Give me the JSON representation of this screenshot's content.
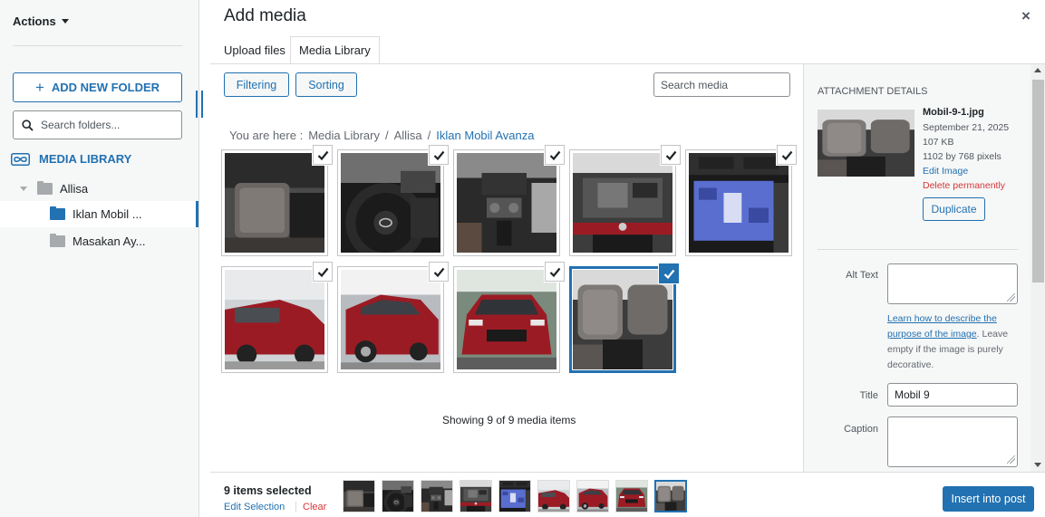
{
  "sidebar": {
    "actions_label": "Actions",
    "add_folder_label": "ADD NEW FOLDER",
    "search_placeholder": "Search folders...",
    "root_label": "MEDIA LIBRARY",
    "folders": [
      {
        "label": "Allisa",
        "level": 0,
        "expanded": true,
        "active": false
      },
      {
        "label": "Iklan Mobil ...",
        "level": 1,
        "active": true
      },
      {
        "label": "Masakan Ay...",
        "level": 1,
        "active": false
      }
    ]
  },
  "modal": {
    "title": "Add media",
    "close_icon": "×",
    "tabs": [
      {
        "label": "Upload files",
        "active": false
      },
      {
        "label": "Media Library",
        "active": true
      }
    ]
  },
  "toolbar": {
    "filtering_label": "Filtering",
    "sorting_label": "Sorting",
    "search_placeholder": "Search media"
  },
  "breadcrumb": {
    "prefix": "You are here :",
    "items": [
      "Media Library",
      "/",
      "Allisa",
      "/",
      "Iklan Mobil Avanza"
    ]
  },
  "grid": {
    "items": [
      {
        "scene": "interior-seat",
        "selected": true,
        "focused": false
      },
      {
        "scene": "steering-wheel",
        "selected": true,
        "focused": false
      },
      {
        "scene": "dashboard-console",
        "selected": true,
        "focused": false
      },
      {
        "scene": "engine-bay",
        "selected": true,
        "focused": false
      },
      {
        "scene": "head-unit-screen",
        "selected": true,
        "focused": false
      },
      {
        "scene": "red-car-side",
        "selected": true,
        "focused": false
      },
      {
        "scene": "red-car-front-side",
        "selected": true,
        "focused": false
      },
      {
        "scene": "red-car-front",
        "selected": true,
        "focused": false
      },
      {
        "scene": "interior-rear-seat",
        "selected": true,
        "focused": true
      }
    ],
    "showing_text": "Showing 9 of 9 media items"
  },
  "attachment": {
    "heading": "ATTACHMENT DETAILS",
    "filename": "Mobil-9-1.jpg",
    "date": "September 21, 2025",
    "size": "107 KB",
    "dimensions": "1102 by 768 pixels",
    "edit_label": "Edit Image",
    "delete_label": "Delete permanently",
    "duplicate_label": "Duplicate",
    "alt_text_label": "Alt Text",
    "alt_text_value": "",
    "alt_help_link": "Learn how to describe the purpose of the image",
    "alt_help_rest": ". Leave empty if the image is purely decorative.",
    "title_label": "Title",
    "title_value": "Mobil 9",
    "caption_label": "Caption",
    "caption_value": ""
  },
  "footer": {
    "selected_count": "9 items selected",
    "edit_selection_label": "Edit Selection",
    "clear_label": "Clear",
    "insert_label": "Insert into post"
  },
  "colors": {
    "accent": "#2271b1",
    "danger": "#d63638",
    "car_red": "#9b1b24"
  }
}
